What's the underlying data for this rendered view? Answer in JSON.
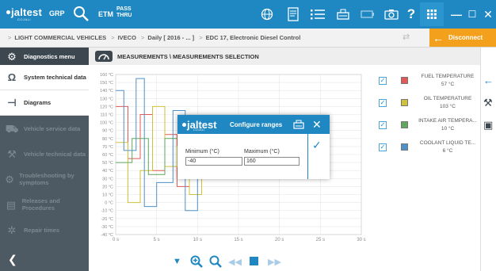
{
  "colors": {
    "primary": "#1f87c1",
    "sidebar": "#4e5a63",
    "accent": "#f3a11c"
  },
  "topbar": {
    "logo_text": "jaltest",
    "logo_sub": "COJALI",
    "grp_label": "GRP",
    "etm_label": "ETM",
    "pass_label": "PASS",
    "thru_label": "THRU",
    "icons": [
      "globe-icon",
      "document-icon",
      "list-icon",
      "keyboard-icon",
      "battery-icon",
      "camera-icon",
      "help-icon",
      "grid-icon",
      "minimize-icon",
      "maximize-icon",
      "close-icon"
    ],
    "help_label": "?",
    "minimize_label": "—",
    "maximize_label": "☐",
    "close_label": "✕"
  },
  "breadcrumb": {
    "items": [
      "LIGHT COMMERCIAL VEHICLES",
      "IVECO",
      "Daily [ 2016 - ... ]",
      "EDC 17, Electronic Diesel Control"
    ],
    "disconnect_label": "Disconnect"
  },
  "sidebar": {
    "header": "Diagnostics menu",
    "items": [
      {
        "label": "System technical data",
        "icon": "omega-icon",
        "enabled": true
      },
      {
        "label": "Diagrams",
        "icon": "diagram-icon",
        "enabled": true
      },
      {
        "label": "Vehicle service data",
        "icon": "truck-icon",
        "enabled": false
      },
      {
        "label": "Vehicle technical data",
        "icon": "wrench-icon",
        "enabled": false
      },
      {
        "label": "Troubleshooting by symptoms",
        "icon": "tools-icon",
        "enabled": false
      },
      {
        "label": "Releases and Procedures",
        "icon": "document-icon",
        "enabled": false
      },
      {
        "label": "Repair times",
        "icon": "gears-icon",
        "enabled": false
      }
    ]
  },
  "panel": {
    "title": "MEASUREMENTS \\ MEASUREMENTS SELECTION"
  },
  "chart_data": {
    "type": "line",
    "title": "",
    "xlabel": "",
    "ylabel": "",
    "x_unit": "s",
    "y_unit": "°C",
    "xlim": [
      0,
      30
    ],
    "ylim": [
      -40,
      160
    ],
    "x_ticks": [
      "0 s",
      "5 s",
      "10 s",
      "15 s",
      "20 s",
      "25 s",
      "30 s"
    ],
    "y_ticks": [
      "160 °C",
      "150 °C",
      "140 °C",
      "130 °C",
      "120 °C",
      "110 °C",
      "100 °C",
      "90 °C",
      "80 °C",
      "70 °C",
      "60 °C",
      "50 °C",
      "40 °C",
      "30 °C",
      "20 °C",
      "10 °C",
      "0 °C",
      "-10 °C",
      "-20 °C",
      "-30 °C",
      "-40 °C"
    ],
    "grid": true,
    "series": [
      {
        "name": "FUEL TEMPERATURE",
        "color": "#e45757",
        "x": [
          0,
          1.5,
          1.5,
          3,
          3,
          4.5,
          4.5,
          6,
          6,
          7.5,
          7.5,
          9,
          9,
          10.5,
          10.5,
          12
        ],
        "y": [
          120,
          120,
          55,
          55,
          110,
          110,
          40,
          40,
          85,
          85,
          20,
          20,
          70,
          70,
          30,
          30
        ]
      },
      {
        "name": "OIL TEMPERATURE",
        "color": "#cfc23b",
        "x": [
          0,
          1.5,
          1.5,
          3,
          3,
          4.5,
          4.5,
          6,
          6,
          7.5,
          7.5,
          9,
          9,
          10.5,
          10.5,
          12
        ],
        "y": [
          75,
          75,
          0,
          0,
          40,
          40,
          120,
          120,
          45,
          45,
          70,
          70,
          10,
          10,
          50,
          50
        ]
      },
      {
        "name": "INTAKE AIR TEMPERA...",
        "color": "#5fa75a",
        "x": [
          0,
          2,
          2,
          4,
          4,
          6,
          6,
          8,
          8,
          10,
          10,
          12
        ],
        "y": [
          50,
          50,
          80,
          80,
          35,
          35,
          80,
          80,
          40,
          40,
          45,
          45
        ]
      },
      {
        "name": "COOLANT LIQUID TE...",
        "color": "#4e90c8",
        "x": [
          0,
          1,
          1,
          2.5,
          2.5,
          3.5,
          3.5,
          5,
          5,
          7,
          7,
          8.5,
          8.5,
          10,
          10,
          12
        ],
        "y": [
          140,
          140,
          65,
          65,
          155,
          155,
          -5,
          -5,
          25,
          25,
          115,
          115,
          -10,
          -10,
          65,
          65
        ]
      }
    ]
  },
  "legend": [
    {
      "name": "FUEL TEMPERATURE",
      "value": "57 °C",
      "color": "#e45757",
      "checked": true
    },
    {
      "name": "OIL TEMPERATURE",
      "value": "103 °C",
      "color": "#cfc23b",
      "checked": true
    },
    {
      "name": "INTAKE AIR TEMPERA...",
      "value": "10 °C",
      "color": "#5fa75a",
      "checked": true
    },
    {
      "name": "COOLANT LIQUID TE...",
      "value": "6 °C",
      "color": "#4e90c8",
      "checked": true
    }
  ],
  "dialog": {
    "logo_text": "jaltest",
    "logo_sub": "COJALI",
    "title": "Configure ranges",
    "min_label": "Minimum (°C)",
    "min_value": "-40",
    "max_label": "Maximum (°C)",
    "max_value": "160",
    "close_label": "✕",
    "ok_label": "✓"
  },
  "bottom_controls": [
    "chevron-down-icon",
    "zoom-in-icon",
    "zoom-out-icon",
    "rewind-icon",
    "stop-icon",
    "fast-forward-icon"
  ]
}
